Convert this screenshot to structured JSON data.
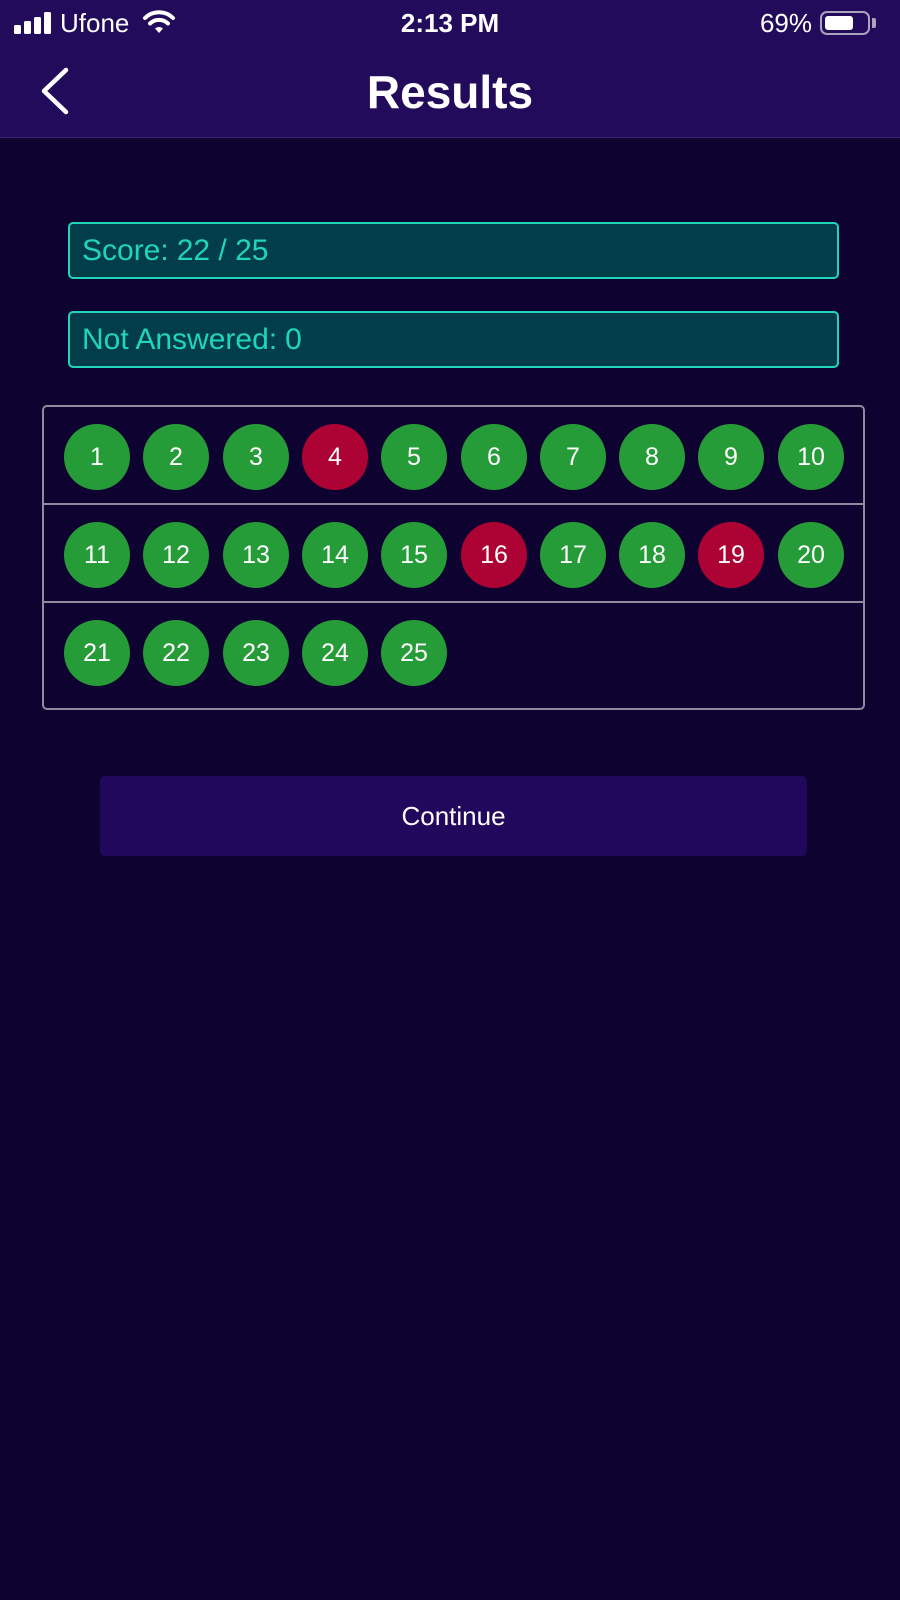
{
  "status_bar": {
    "carrier": "Ufone",
    "time": "2:13 PM",
    "battery_percent": "69%",
    "battery_level": 0.69,
    "icons": [
      "signal-icon",
      "wifi-icon",
      "battery-icon"
    ]
  },
  "nav": {
    "title": "Results",
    "back_icon": "chevron-left-icon"
  },
  "stats": {
    "score_label": "Score:",
    "score_value": "22 / 25",
    "not_answered_label": "Not Answered:",
    "not_answered_value": "0"
  },
  "questions": [
    {
      "number": "1",
      "status": "correct"
    },
    {
      "number": "2",
      "status": "correct"
    },
    {
      "number": "3",
      "status": "correct"
    },
    {
      "number": "4",
      "status": "wrong"
    },
    {
      "number": "5",
      "status": "correct"
    },
    {
      "number": "6",
      "status": "correct"
    },
    {
      "number": "7",
      "status": "correct"
    },
    {
      "number": "8",
      "status": "correct"
    },
    {
      "number": "9",
      "status": "correct"
    },
    {
      "number": "10",
      "status": "correct"
    },
    {
      "number": "11",
      "status": "correct"
    },
    {
      "number": "12",
      "status": "correct"
    },
    {
      "number": "13",
      "status": "correct"
    },
    {
      "number": "14",
      "status": "correct"
    },
    {
      "number": "15",
      "status": "correct"
    },
    {
      "number": "16",
      "status": "wrong"
    },
    {
      "number": "17",
      "status": "correct"
    },
    {
      "number": "18",
      "status": "correct"
    },
    {
      "number": "19",
      "status": "wrong"
    },
    {
      "number": "20",
      "status": "correct"
    },
    {
      "number": "21",
      "status": "correct"
    },
    {
      "number": "22",
      "status": "correct"
    },
    {
      "number": "23",
      "status": "correct"
    },
    {
      "number": "24",
      "status": "correct"
    },
    {
      "number": "25",
      "status": "correct"
    }
  ],
  "colors": {
    "background": "#0e0330",
    "header": "#230b5c",
    "accent": "#1fd6b8",
    "stat_box_fill": "#023d4a",
    "correct": "#259c37",
    "wrong": "#ad0234",
    "button": "#22085d"
  },
  "actions": {
    "continue_label": "Continue"
  }
}
